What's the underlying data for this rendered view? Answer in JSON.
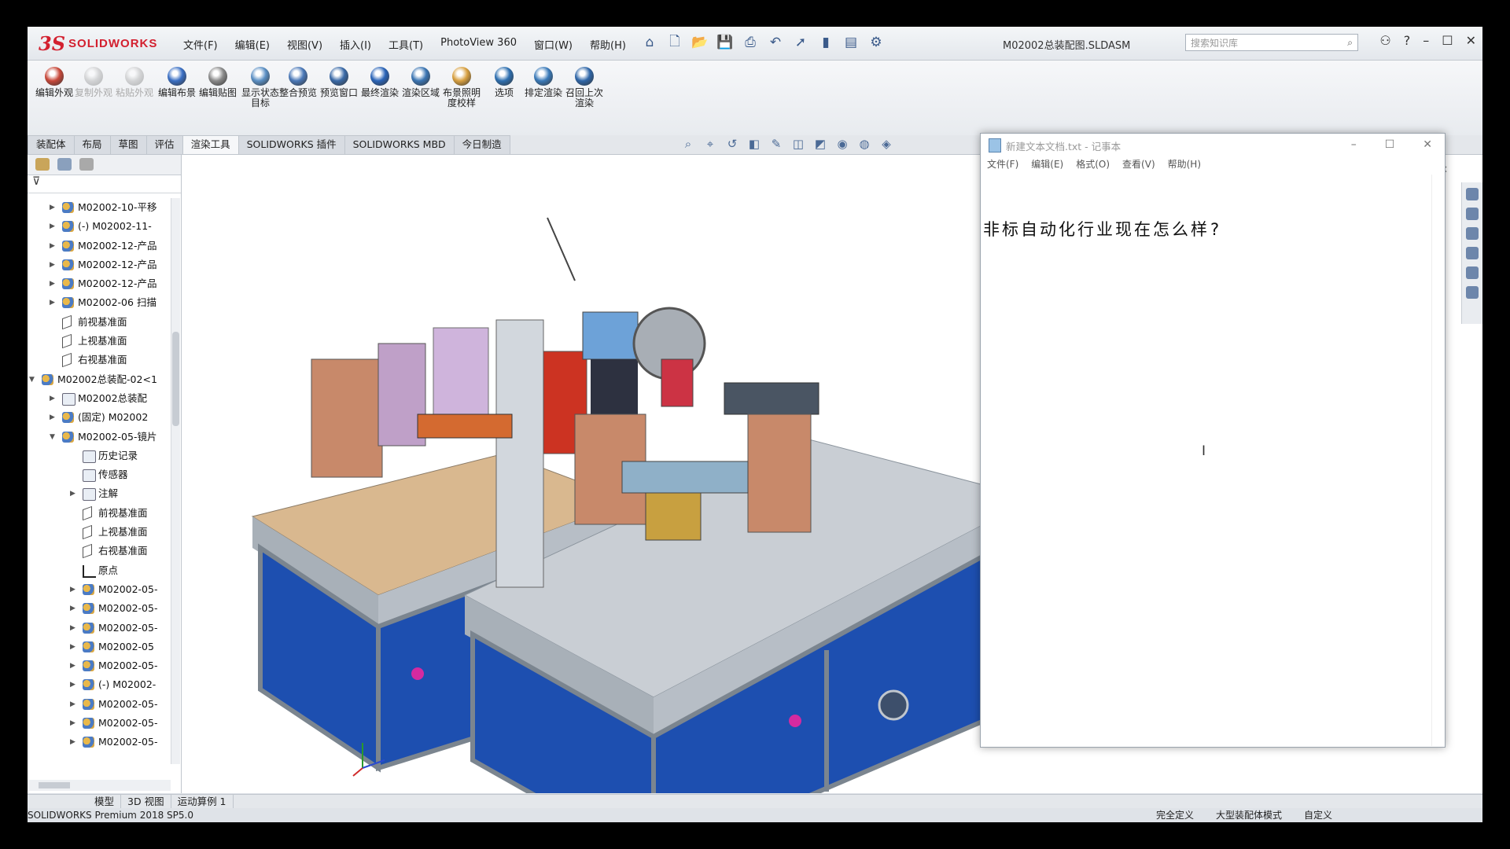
{
  "app": {
    "brand": "SOLIDWORKS",
    "document_title": "M02002总装配图.SLDASM",
    "menu": [
      "文件(F)",
      "编辑(E)",
      "视图(V)",
      "插入(I)",
      "工具(T)",
      "PhotoView 360",
      "窗口(W)",
      "帮助(H)"
    ],
    "search_placeholder": "搜索知识库"
  },
  "command_buttons": [
    {
      "label": "编辑外观",
      "enabled": true,
      "color": "#c8483a"
    },
    {
      "label": "复制外观",
      "enabled": false,
      "color": "#999999"
    },
    {
      "label": "粘贴外观",
      "enabled": false,
      "color": "#999999"
    },
    {
      "label": "编辑布景",
      "enabled": true,
      "color": "#3a6fc4"
    },
    {
      "label": "编辑贴图",
      "enabled": true,
      "color": "#8a8a8a"
    },
    {
      "label": "显示状态目标",
      "enabled": true,
      "color": "#5a8fc4"
    },
    {
      "label": "整合预览",
      "enabled": true,
      "color": "#4a78b8"
    },
    {
      "label": "预览窗口",
      "enabled": true,
      "color": "#3a6aa8"
    },
    {
      "label": "最终渲染",
      "enabled": true,
      "color": "#2a64b8"
    },
    {
      "label": "渲染区域",
      "enabled": true,
      "color": "#3b75b3"
    },
    {
      "label": "布景照明度校样",
      "enabled": true,
      "color": "#d8a040"
    },
    {
      "label": "选项",
      "enabled": true,
      "color": "#2d6fb0"
    },
    {
      "label": "排定渲染",
      "enabled": true,
      "color": "#3a7ab9"
    },
    {
      "label": "召回上次渲染",
      "enabled": true,
      "color": "#2e66a8"
    }
  ],
  "tabs": [
    {
      "label": "装配体",
      "active": false
    },
    {
      "label": "布局",
      "active": false
    },
    {
      "label": "草图",
      "active": false
    },
    {
      "label": "评估",
      "active": false
    },
    {
      "label": "渲染工具",
      "active": true
    },
    {
      "label": "SOLIDWORKS 插件",
      "active": false
    },
    {
      "label": "SOLIDWORKS MBD",
      "active": false
    },
    {
      "label": "今日制造",
      "active": false
    }
  ],
  "tree": [
    {
      "indent": 1,
      "arrow": "right",
      "icon": "asm",
      "label": "M02002-10-平移"
    },
    {
      "indent": 1,
      "arrow": "right",
      "icon": "asm",
      "label": "(-) M02002-11-"
    },
    {
      "indent": 1,
      "arrow": "right",
      "icon": "asm",
      "label": "M02002-12-产品"
    },
    {
      "indent": 1,
      "arrow": "right",
      "icon": "asm",
      "label": "M02002-12-产品"
    },
    {
      "indent": 1,
      "arrow": "right",
      "icon": "asm",
      "label": "M02002-12-产品"
    },
    {
      "indent": 1,
      "arrow": "right",
      "icon": "asm",
      "label": "M02002-06 扫描"
    },
    {
      "indent": 1,
      "arrow": "",
      "icon": "plane",
      "label": "前视基准面"
    },
    {
      "indent": 1,
      "arrow": "",
      "icon": "plane",
      "label": "上视基准面"
    },
    {
      "indent": 1,
      "arrow": "",
      "icon": "plane",
      "label": "右视基准面"
    },
    {
      "indent": 0,
      "arrow": "down",
      "icon": "asm",
      "label": "M02002总装配-02<1"
    },
    {
      "indent": 1,
      "arrow": "right",
      "icon": "folder",
      "label": "M02002总装配"
    },
    {
      "indent": 1,
      "arrow": "right",
      "icon": "asm",
      "label": "(固定) M02002"
    },
    {
      "indent": 1,
      "arrow": "down",
      "icon": "asm",
      "label": "M02002-05-镜片"
    },
    {
      "indent": 2,
      "arrow": "",
      "icon": "folder",
      "label": "历史记录"
    },
    {
      "indent": 2,
      "arrow": "",
      "icon": "folder",
      "label": "传感器"
    },
    {
      "indent": 2,
      "arrow": "right",
      "icon": "folder",
      "label": "注解"
    },
    {
      "indent": 2,
      "arrow": "",
      "icon": "plane",
      "label": "前视基准面"
    },
    {
      "indent": 2,
      "arrow": "",
      "icon": "plane",
      "label": "上视基准面"
    },
    {
      "indent": 2,
      "arrow": "",
      "icon": "plane",
      "label": "右视基准面"
    },
    {
      "indent": 2,
      "arrow": "",
      "icon": "orig",
      "label": "原点"
    },
    {
      "indent": 2,
      "arrow": "right",
      "icon": "asm",
      "label": "M02002-05-"
    },
    {
      "indent": 2,
      "arrow": "right",
      "icon": "asm",
      "label": "M02002-05-"
    },
    {
      "indent": 2,
      "arrow": "right",
      "icon": "asm",
      "label": "M02002-05-"
    },
    {
      "indent": 2,
      "arrow": "right",
      "icon": "asm",
      "label": "M02002-05"
    },
    {
      "indent": 2,
      "arrow": "right",
      "icon": "asm",
      "label": "M02002-05-"
    },
    {
      "indent": 2,
      "arrow": "right",
      "icon": "asm",
      "label": "(-) M02002-"
    },
    {
      "indent": 2,
      "arrow": "right",
      "icon": "asm",
      "label": "M02002-05-"
    },
    {
      "indent": 2,
      "arrow": "right",
      "icon": "asm",
      "label": "M02002-05-"
    },
    {
      "indent": 2,
      "arrow": "right",
      "icon": "asm",
      "label": "M02002-05-"
    }
  ],
  "notepad": {
    "title": "新建文本文档.txt - 记事本",
    "menu": [
      "文件(F)",
      "编辑(E)",
      "格式(O)",
      "查看(V)",
      "帮助(H)"
    ],
    "text": "非标自动化行业现在怎么样?"
  },
  "bottom_tabs": [
    "模型",
    "3D 视图",
    "运动算例 1"
  ],
  "status": {
    "version": "SOLIDWORKS Premium 2018 SP5.0",
    "right": [
      "完全定义",
      "大型装配体模式",
      "自定义"
    ]
  },
  "colors": {
    "cabinet_blue": "#1d4fb0",
    "frame_gray": "#8e98a3",
    "tabletop_wood": "#d9b88f",
    "accent_red": "#d3202f"
  }
}
